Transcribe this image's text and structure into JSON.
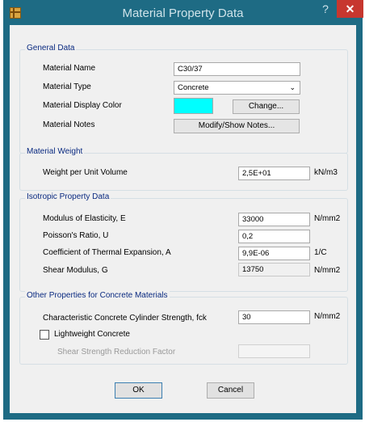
{
  "window": {
    "title": "Material Property Data",
    "help_label": "?",
    "close_label": "✕"
  },
  "general": {
    "legend": "General Data",
    "name_label": "Material Name",
    "name_value": "C30/37",
    "type_label": "Material Type",
    "type_value": "Concrete",
    "color_label": "Material Display Color",
    "color_hex": "#00FFFF",
    "change_label": "Change...",
    "notes_label": "Material Notes",
    "notes_button": "Modify/Show Notes..."
  },
  "weight": {
    "legend": "Material Weight",
    "label": "Weight per Unit Volume",
    "value": "2,5E+01",
    "unit": "kN/m3"
  },
  "isotropic": {
    "legend": "Isotropic Property Data",
    "rows": [
      {
        "label": "Modulus of Elasticity,  E",
        "value": "33000",
        "unit": "N/mm2"
      },
      {
        "label": "Poisson's Ratio,  U",
        "value": "0,2",
        "unit": ""
      },
      {
        "label": "Coefficient of Thermal Expansion,  A",
        "value": "9,9E-06",
        "unit": "1/C"
      },
      {
        "label": "Shear Modulus,  G",
        "value": "13750",
        "unit": "N/mm2"
      }
    ]
  },
  "concrete": {
    "legend": "Other Properties for Concrete Materials",
    "fck_label": "Characteristic Concrete Cylinder Strength, fck",
    "fck_value": "30",
    "fck_unit": "N/mm2",
    "lightweight_label": "Lightweight Concrete",
    "lightweight_checked": false,
    "reduction_label": "Shear Strength Reduction Factor",
    "reduction_value": ""
  },
  "actions": {
    "ok_label": "OK",
    "cancel_label": "Cancel"
  }
}
